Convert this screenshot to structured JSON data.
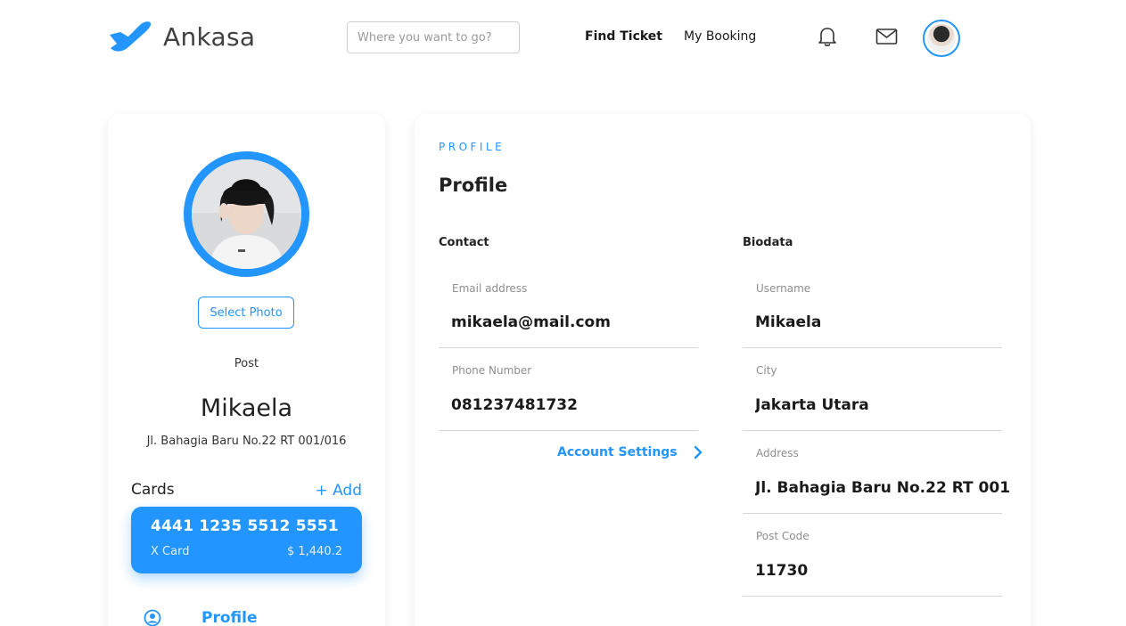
{
  "header": {
    "brand": "Ankasa",
    "search_placeholder": "Where you want to go?",
    "nav": {
      "find_ticket": "Find Ticket",
      "my_booking": "My Booking"
    },
    "icons": {
      "logo": "plane-logo-icon",
      "notifications": "bell-icon",
      "messages": "mail-icon"
    }
  },
  "sidebar": {
    "select_photo": "Select Photo",
    "role": "Post",
    "name": "Mikaela",
    "address": "Jl. Bahagia Baru No.22 RT 001/016",
    "cards_label": "Cards",
    "add_label": "+ Add",
    "card": {
      "number": "4441 1235 5512 5551",
      "name": "X Card",
      "balance": "$ 1,440.2"
    },
    "menu": {
      "profile": "Profile"
    }
  },
  "profile": {
    "eyebrow": "PROFILE",
    "title": "Profile",
    "contact": {
      "heading": "Contact",
      "email_label": "Email address",
      "email_value": "mikaela@mail.com",
      "phone_label": "Phone Number",
      "phone_value": "081237481732",
      "account_settings": "Account Settings"
    },
    "biodata": {
      "heading": "Biodata",
      "username_label": "Username",
      "username_value": "Mikaela",
      "city_label": "City",
      "city_value": "Jakarta Utara",
      "address_label": "Address",
      "address_value": "Jl. Bahagia Baru No.22 RT 001",
      "postcode_label": "Post Code",
      "postcode_value": "11730"
    }
  },
  "colors": {
    "accent": "#2395ff",
    "text": "#1a1a1a",
    "muted": "#8e8e8e",
    "divider": "#d6d6d6"
  }
}
